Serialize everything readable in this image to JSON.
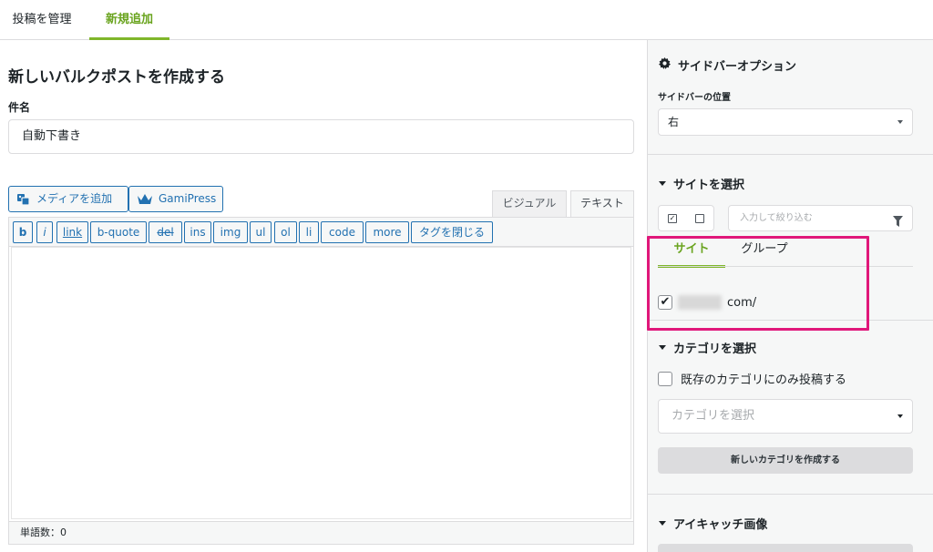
{
  "top_nav": {
    "tabs": [
      {
        "label": "投稿を管理",
        "active": false
      },
      {
        "label": "新規追加",
        "active": true
      }
    ]
  },
  "main": {
    "page_title": "新しいバルクポストを作成する",
    "title_label": "件名",
    "title_value": "自動下書き",
    "media_buttons": [
      {
        "label": "メディアを追加",
        "icon": "media-icon"
      },
      {
        "label": "GamiPress",
        "icon": "crown-icon"
      }
    ],
    "editor_tabs": {
      "visual": "ビジュアル",
      "text": "テキスト",
      "active": "text"
    },
    "quicktags": [
      "b",
      "i",
      "link",
      "b-quote",
      "del",
      "ins",
      "img",
      "ul",
      "ol",
      "li",
      "code",
      "more",
      "タグを閉じる"
    ],
    "word_count": "単語数：0"
  },
  "sidebar": {
    "options": {
      "heading": "サイドバーオプション",
      "icon": "gear-icon",
      "position_label": "サイドバーの位置",
      "position_value": "右"
    },
    "sites": {
      "heading": "サイトを選択",
      "filter_placeholder": "入力して絞り込む",
      "tabs": [
        {
          "label": "サイト",
          "active": true
        },
        {
          "label": "グループ",
          "active": false
        }
      ],
      "site_item": {
        "suffix": "com/",
        "checked": true
      }
    },
    "categories": {
      "heading": "カテゴリを選択",
      "only_existing_label": "既存のカテゴリにのみ投稿する",
      "select_placeholder": "カテゴリを選択",
      "create_button": "新しいカテゴリを作成する"
    },
    "featured": {
      "heading": "アイキャッチ画像"
    }
  },
  "colors": {
    "accent_green": "#7fb62a",
    "link_blue": "#2271b1",
    "highlight_pink": "#e0177a"
  }
}
